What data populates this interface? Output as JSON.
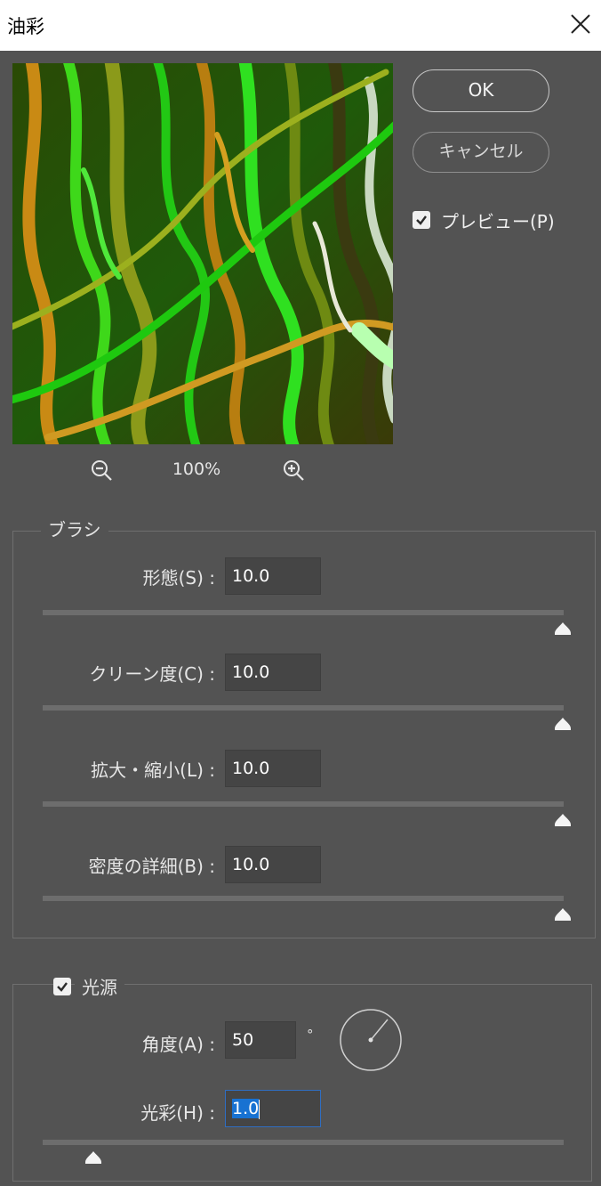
{
  "dialog": {
    "title": "油彩"
  },
  "preview": {
    "zoom": "100%"
  },
  "buttons": {
    "ok": "OK",
    "cancel": "キャンセル"
  },
  "preview_toggle": {
    "label": "プレビュー(P)",
    "checked": true
  },
  "brush": {
    "legend": "ブラシ",
    "fields": [
      {
        "label": "形態(S) :",
        "value": "10.0",
        "slider_fraction": 1.0
      },
      {
        "label": "クリーン度(C) :",
        "value": "10.0",
        "slider_fraction": 1.0
      },
      {
        "label": "拡大・縮小(L) :",
        "value": "10.0",
        "slider_fraction": 1.0
      },
      {
        "label": "密度の詳細(B) :",
        "value": "10.0",
        "slider_fraction": 1.0
      }
    ]
  },
  "lighting": {
    "legend": "光源",
    "checked": true,
    "angle": {
      "label": "角度(A) :",
      "value": "50",
      "unit": "°"
    },
    "shine": {
      "label": "光彩(H) :",
      "value": "1.0",
      "slider_fraction": 0.1
    }
  },
  "colors": {
    "background": "#535353",
    "selection": "#1872d2",
    "focus": "#2f6ec2"
  },
  "icons": [
    "close-icon",
    "zoom-out-icon",
    "zoom-in-icon",
    "checkmark-icon",
    "slider-thumb-icon",
    "angle-dial-icon"
  ]
}
